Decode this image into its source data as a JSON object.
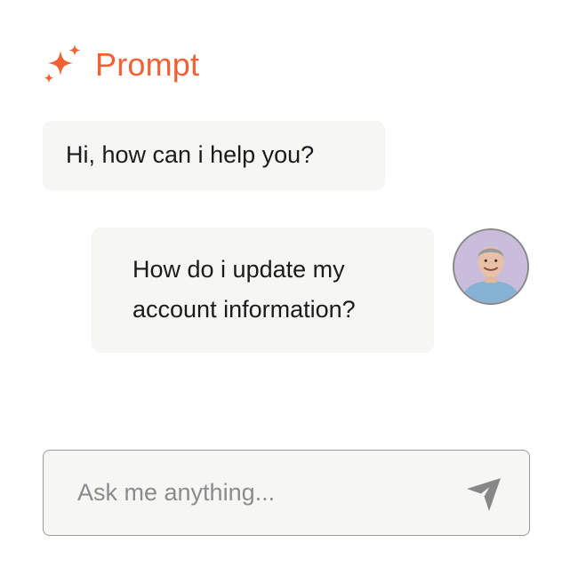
{
  "app": {
    "title": "Prompt",
    "logo_icon": "sparkle-icon",
    "accent_color": "#f26134"
  },
  "chat": {
    "messages": [
      {
        "role": "assistant",
        "text": "Hi, how can i help you?"
      },
      {
        "role": "user",
        "lines": [
          "How do i update my",
          "account information?"
        ],
        "avatar_icon": "user-avatar"
      }
    ]
  },
  "composer": {
    "placeholder": "Ask me anything...",
    "value": "",
    "send_icon": "send-icon"
  }
}
